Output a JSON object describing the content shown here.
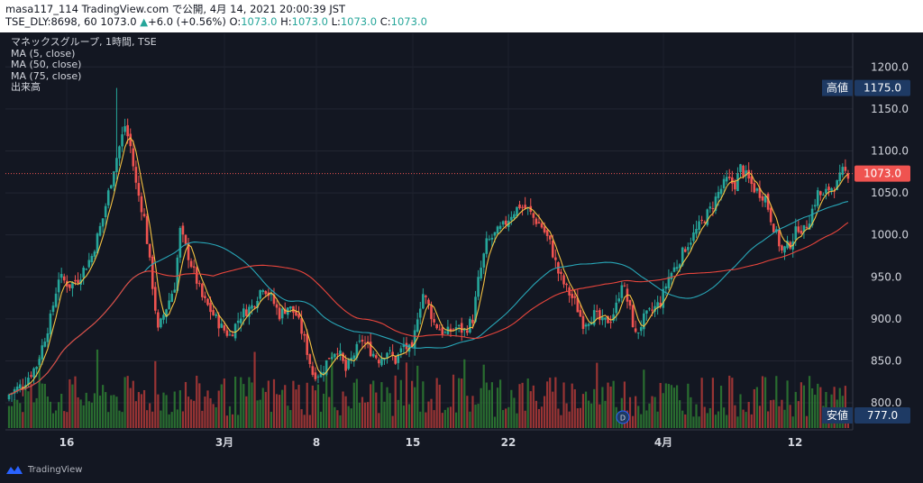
{
  "header": {
    "line1": "masa117_114 TradingView.com で公開, 4月 14, 2021 20:00:39 JST",
    "symbol": "TSE_DLY:8698, 60",
    "last": "1073.0",
    "change_icon": "triangle-up-icon",
    "change": "+6.0 (+0.56%)",
    "o_label": "O:",
    "o_value": "1073.0",
    "h_label": "H:",
    "h_value": "1073.0",
    "l_label": "L:",
    "l_value": "1073.0",
    "c_label": "C:",
    "c_value": "1073.0"
  },
  "legend": {
    "title": "マネックスグループ, 1時間, TSE",
    "ma5": "MA (5, close)",
    "ma50": "MA (50, close)",
    "ma75": "MA (75, close)",
    "volume": "出来高"
  },
  "markers": {
    "high_label": "高値",
    "high_value": "1175.0",
    "low_label": "安値",
    "low_value": "777.0",
    "last_value": "1073.0",
    "dividend_icon": "D"
  },
  "footer": {
    "brand": "TradingView"
  },
  "colors": {
    "background": "#131722",
    "up": "#26a69a",
    "down": "#ef5350",
    "ma5": "#f5c242",
    "ma50": "#28a6b7",
    "ma75": "#e8453c",
    "marker_bg": "#1e3a64",
    "last_price_bg": "#ef5350"
  },
  "chart_data": {
    "type": "candlestick",
    "y_axis": {
      "ticks": [
        800,
        850,
        900,
        950,
        1000,
        1050,
        1100,
        1150,
        1200
      ],
      "tick_labels": [
        "800.0",
        "850.0",
        "900.0",
        "950.0",
        "1000.0",
        "1050.0",
        "1100.0",
        "1150.0",
        "1200.0"
      ],
      "range": [
        770,
        1240
      ]
    },
    "x_axis": {
      "tick_labels": [
        "16",
        "3月",
        "8",
        "15",
        "22",
        "4月",
        "12"
      ]
    },
    "grid": true,
    "legend_position": "top-left",
    "close_path": [
      [
        0,
        810
      ],
      [
        5,
        822
      ],
      [
        10,
        845
      ],
      [
        15,
        900
      ],
      [
        18,
        950
      ],
      [
        22,
        940
      ],
      [
        25,
        948
      ],
      [
        30,
        975
      ],
      [
        34,
        1020
      ],
      [
        38,
        1080
      ],
      [
        42,
        1130
      ],
      [
        44,
        1105
      ],
      [
        46,
        1060
      ],
      [
        49,
        1020
      ],
      [
        52,
        940
      ],
      [
        54,
        885
      ],
      [
        56,
        905
      ],
      [
        60,
        940
      ],
      [
        62,
        1005
      ],
      [
        66,
        965
      ],
      [
        70,
        925
      ],
      [
        74,
        905
      ],
      [
        77,
        890
      ],
      [
        80,
        880
      ],
      [
        84,
        905
      ],
      [
        88,
        915
      ],
      [
        92,
        940
      ],
      [
        95,
        925
      ],
      [
        98,
        905
      ],
      [
        101,
        915
      ],
      [
        104,
        905
      ],
      [
        107,
        875
      ],
      [
        110,
        835
      ],
      [
        113,
        835
      ],
      [
        116,
        855
      ],
      [
        119,
        865
      ],
      [
        122,
        838
      ],
      [
        125,
        858
      ],
      [
        128,
        875
      ],
      [
        131,
        862
      ],
      [
        134,
        852
      ],
      [
        137,
        862
      ],
      [
        140,
        850
      ],
      [
        143,
        868
      ],
      [
        146,
        860
      ],
      [
        148,
        905
      ],
      [
        150,
        930
      ],
      [
        152,
        915
      ],
      [
        154,
        895
      ],
      [
        158,
        882
      ],
      [
        162,
        890
      ],
      [
        165,
        885
      ],
      [
        168,
        900
      ],
      [
        170,
        945
      ],
      [
        173,
        990
      ],
      [
        176,
        1000
      ],
      [
        179,
        1010
      ],
      [
        182,
        1025
      ],
      [
        185,
        1035
      ],
      [
        188,
        1030
      ],
      [
        190,
        1020
      ],
      [
        193,
        1010
      ],
      [
        196,
        990
      ],
      [
        199,
        955
      ],
      [
        202,
        935
      ],
      [
        205,
        920
      ],
      [
        208,
        895
      ],
      [
        212,
        905
      ],
      [
        215,
        895
      ],
      [
        218,
        900
      ],
      [
        220,
        915
      ],
      [
        222,
        945
      ],
      [
        225,
        910
      ],
      [
        227,
        880
      ],
      [
        230,
        900
      ],
      [
        233,
        910
      ],
      [
        236,
        920
      ],
      [
        239,
        950
      ],
      [
        242,
        965
      ],
      [
        245,
        985
      ],
      [
        248,
        1000
      ],
      [
        251,
        1015
      ],
      [
        254,
        1030
      ],
      [
        257,
        1050
      ],
      [
        260,
        1065
      ],
      [
        263,
        1060
      ],
      [
        265,
        1080
      ],
      [
        268,
        1065
      ],
      [
        270,
        1055
      ],
      [
        272,
        1050
      ],
      [
        274,
        1045
      ],
      [
        276,
        1020
      ],
      [
        278,
        1000
      ],
      [
        280,
        980
      ],
      [
        283,
        990
      ],
      [
        286,
        1010
      ],
      [
        288,
        1005
      ],
      [
        290,
        1020
      ],
      [
        293,
        1050
      ],
      [
        295,
        1045
      ],
      [
        297,
        1055
      ],
      [
        300,
        1060
      ],
      [
        302,
        1075
      ],
      [
        304,
        1073
      ]
    ],
    "series": [
      {
        "name": "MA (5, close)",
        "color": "#f5c242",
        "window": 5
      },
      {
        "name": "MA (50, close)",
        "color": "#28a6b7",
        "window": 50
      },
      {
        "name": "MA (75, close)",
        "color": "#e8453c",
        "window": 75
      }
    ],
    "high": 1175.0,
    "low": 777.0,
    "last": 1073.0
  }
}
